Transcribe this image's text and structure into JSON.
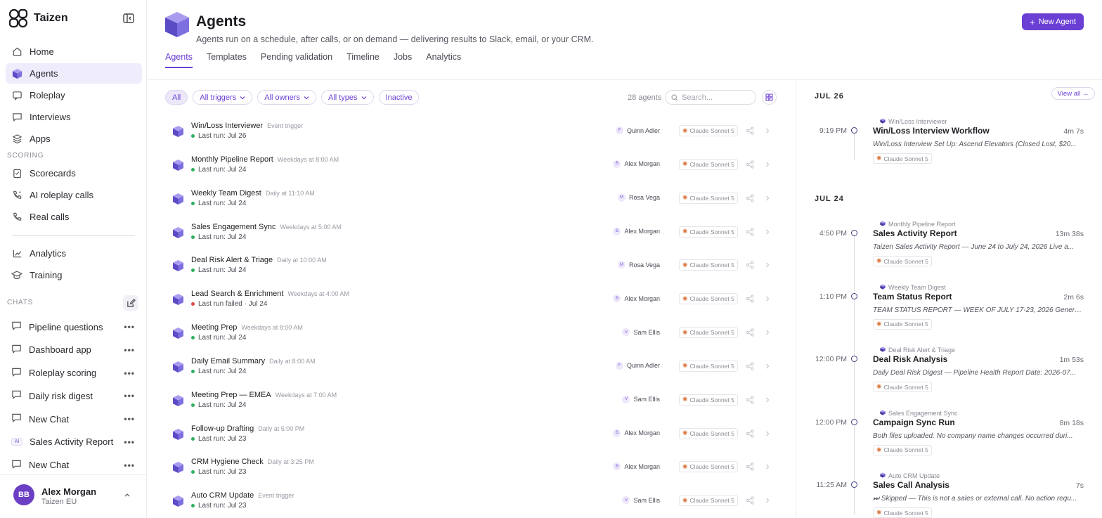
{
  "brand": {
    "name": "Taizen"
  },
  "nav": [
    {
      "label": "Home",
      "icon": "home-icon"
    },
    {
      "label": "Agents",
      "icon": "cube-icon",
      "active": true
    },
    {
      "label": "Roleplay",
      "icon": "roleplay-icon"
    },
    {
      "label": "Interviews",
      "icon": "chat-icon"
    },
    {
      "label": "Apps",
      "icon": "apps-icon"
    }
  ],
  "scoring": {
    "label": "SCORING",
    "items": [
      {
        "label": "Scorecards",
        "icon": "clipboard-icon"
      },
      {
        "label": "AI roleplay calls",
        "icon": "ai-phone-icon"
      },
      {
        "label": "Real calls",
        "icon": "phone-icon"
      }
    ]
  },
  "more_nav": [
    {
      "label": "Analytics",
      "icon": "chart-icon"
    },
    {
      "label": "Training",
      "icon": "graduation-icon"
    }
  ],
  "chats": {
    "label": "CHATS",
    "items": [
      {
        "label": "Pipeline questions",
        "ai": false
      },
      {
        "label": "Dashboard app",
        "ai": false
      },
      {
        "label": "Roleplay scoring",
        "ai": false
      },
      {
        "label": "Daily risk digest",
        "ai": false
      },
      {
        "label": "New Chat",
        "ai": false
      },
      {
        "label": "Sales Activity Report",
        "ai": true,
        "badge": "AI"
      },
      {
        "label": "New Chat",
        "ai": false
      }
    ]
  },
  "user": {
    "initials": "BB",
    "name": "Alex Morgan",
    "org": "Taizen EU"
  },
  "header": {
    "title": "Agents",
    "subtitle": "Agents run on a schedule, after calls, or on demand — delivering results to Slack, email, or your CRM.",
    "new_button": "New Agent"
  },
  "tabs": [
    {
      "label": "Agents",
      "active": true
    },
    {
      "label": "Templates"
    },
    {
      "label": "Pending validation"
    },
    {
      "label": "Timeline"
    },
    {
      "label": "Jobs"
    },
    {
      "label": "Analytics"
    }
  ],
  "filters": {
    "all": "All",
    "triggers": "All triggers",
    "owners": "All owners",
    "types": "All types",
    "inactive": "Inactive",
    "count": "28 agents",
    "search_placeholder": "Search..."
  },
  "agents": [
    {
      "name": "Win/Loss Interviewer",
      "trigger": "Event trigger",
      "last": "Last run: Jul 26",
      "status": "ok",
      "owner": "Quinn Adler",
      "owner_initial": "F",
      "model": "Claude Sonnet 5"
    },
    {
      "name": "Monthly Pipeline Report",
      "trigger": "Weekdays at 8:00 AM",
      "last": "Last run: Jul 24",
      "status": "ok",
      "owner": "Alex Morgan",
      "owner_initial": "B",
      "model": "Claude Sonnet 5"
    },
    {
      "name": "Weekly Team Digest",
      "trigger": "Daily at 11:10 AM",
      "last": "Last run: Jul 24",
      "status": "ok",
      "owner": "Rosa Vega",
      "owner_initial": "M",
      "model": "Claude Sonnet 5"
    },
    {
      "name": "Sales Engagement Sync",
      "trigger": "Weekdays at 5:00 AM",
      "last": "Last run: Jul 24",
      "status": "ok",
      "owner": "Alex Morgan",
      "owner_initial": "B",
      "model": "Claude Sonnet 5"
    },
    {
      "name": "Deal Risk Alert & Triage",
      "trigger": "Daily at 10:00 AM",
      "last": "Last run: Jul 24",
      "status": "ok",
      "owner": "Rosa Vega",
      "owner_initial": "M",
      "model": "Claude Sonnet 5"
    },
    {
      "name": "Lead Search & Enrichment",
      "trigger": "Weekdays at 4:00 AM",
      "last": "Last run failed · Jul 24",
      "status": "fail",
      "owner": "Alex Morgan",
      "owner_initial": "B",
      "model": "Claude Sonnet 5"
    },
    {
      "name": "Meeting Prep",
      "trigger": "Weekdays at 8:00 AM",
      "last": "Last run: Jul 24",
      "status": "ok",
      "owner": "Sam Ellis",
      "owner_initial": "V",
      "model": "Claude Sonnet 5"
    },
    {
      "name": "Daily Email Summary",
      "trigger": "Daily at 8:00 AM",
      "last": "Last run: Jul 24",
      "status": "ok",
      "owner": "Quinn Adler",
      "owner_initial": "F",
      "model": "Claude Sonnet 5"
    },
    {
      "name": "Meeting Prep — EMEA",
      "trigger": "Weekdays at 7:00 AM",
      "last": "Last run: Jul 24",
      "status": "ok",
      "owner": "Sam Ellis",
      "owner_initial": "V",
      "model": "Claude Sonnet 5"
    },
    {
      "name": "Follow-up Drafting",
      "trigger": "Daily at 5:00 PM",
      "last": "Last run: Jul 23",
      "status": "ok",
      "owner": "Alex Morgan",
      "owner_initial": "B",
      "model": "Claude Sonnet 5"
    },
    {
      "name": "CRM Hygiene Check",
      "trigger": "Daily at 3:25 PM",
      "last": "Last run: Jul 23",
      "status": "ok",
      "owner": "Alex Morgan",
      "owner_initial": "B",
      "model": "Claude Sonnet 5"
    },
    {
      "name": "Auto CRM Update",
      "trigger": "Event trigger",
      "last": "Last run: Jul 23",
      "status": "ok",
      "owner": "Sam Ellis",
      "owner_initial": "V",
      "model": "Claude Sonnet 5"
    }
  ],
  "timeline": {
    "view_all": "View all →",
    "groups": [
      {
        "date": "JUL 26",
        "items": [
          {
            "time": "9:19 PM",
            "agent": "Win/Loss Interviewer",
            "title": "Win/Loss Interview Workflow",
            "duration": "4m 7s",
            "snippet": "Win/Loss Interview Set Up: Ascend Elevators (Closed Lost, $20...",
            "model": "Claude Sonnet 5"
          }
        ]
      },
      {
        "date": "JUL 24",
        "items": [
          {
            "time": "4:50 PM",
            "agent": "Monthly Pipeline Report",
            "title": "Sales Activity Report",
            "duration": "13m 38s",
            "snippet": "Taizen Sales Activity Report — June 24 to July 24, 2026 Live a...",
            "model": "Claude Sonnet 5"
          },
          {
            "time": "1:10 PM",
            "agent": "Weekly Team Digest",
            "title": "Team Status Report",
            "duration": "2m 6s",
            "snippet": "TEAM STATUS REPORT — WEEK OF JULY 17-23, 2026 Genera...",
            "model": "Claude Sonnet 5"
          },
          {
            "time": "12:00 PM",
            "agent": "Deal Risk Alert & Triage",
            "title": "Deal Risk Analysis",
            "duration": "1m 53s",
            "snippet": "Daily Deal Risk Digest — Pipeline Health Report Date: 2026-07...",
            "model": "Claude Sonnet 5"
          },
          {
            "time": "12:00 PM",
            "agent": "Sales Engagement Sync",
            "title": "Campaign Sync Run",
            "duration": "8m 18s",
            "snippet": "Both files uploaded. No company name changes occurred duri...",
            "model": "Claude Sonnet 5"
          },
          {
            "time": "11:25 AM",
            "agent": "Auto CRM Update",
            "title": "Sales Call Analysis",
            "duration": "7s",
            "snippet": "⏭ Skipped — This is not a sales or external call. No action requ...",
            "model": "Claude Sonnet 5"
          }
        ]
      }
    ]
  }
}
